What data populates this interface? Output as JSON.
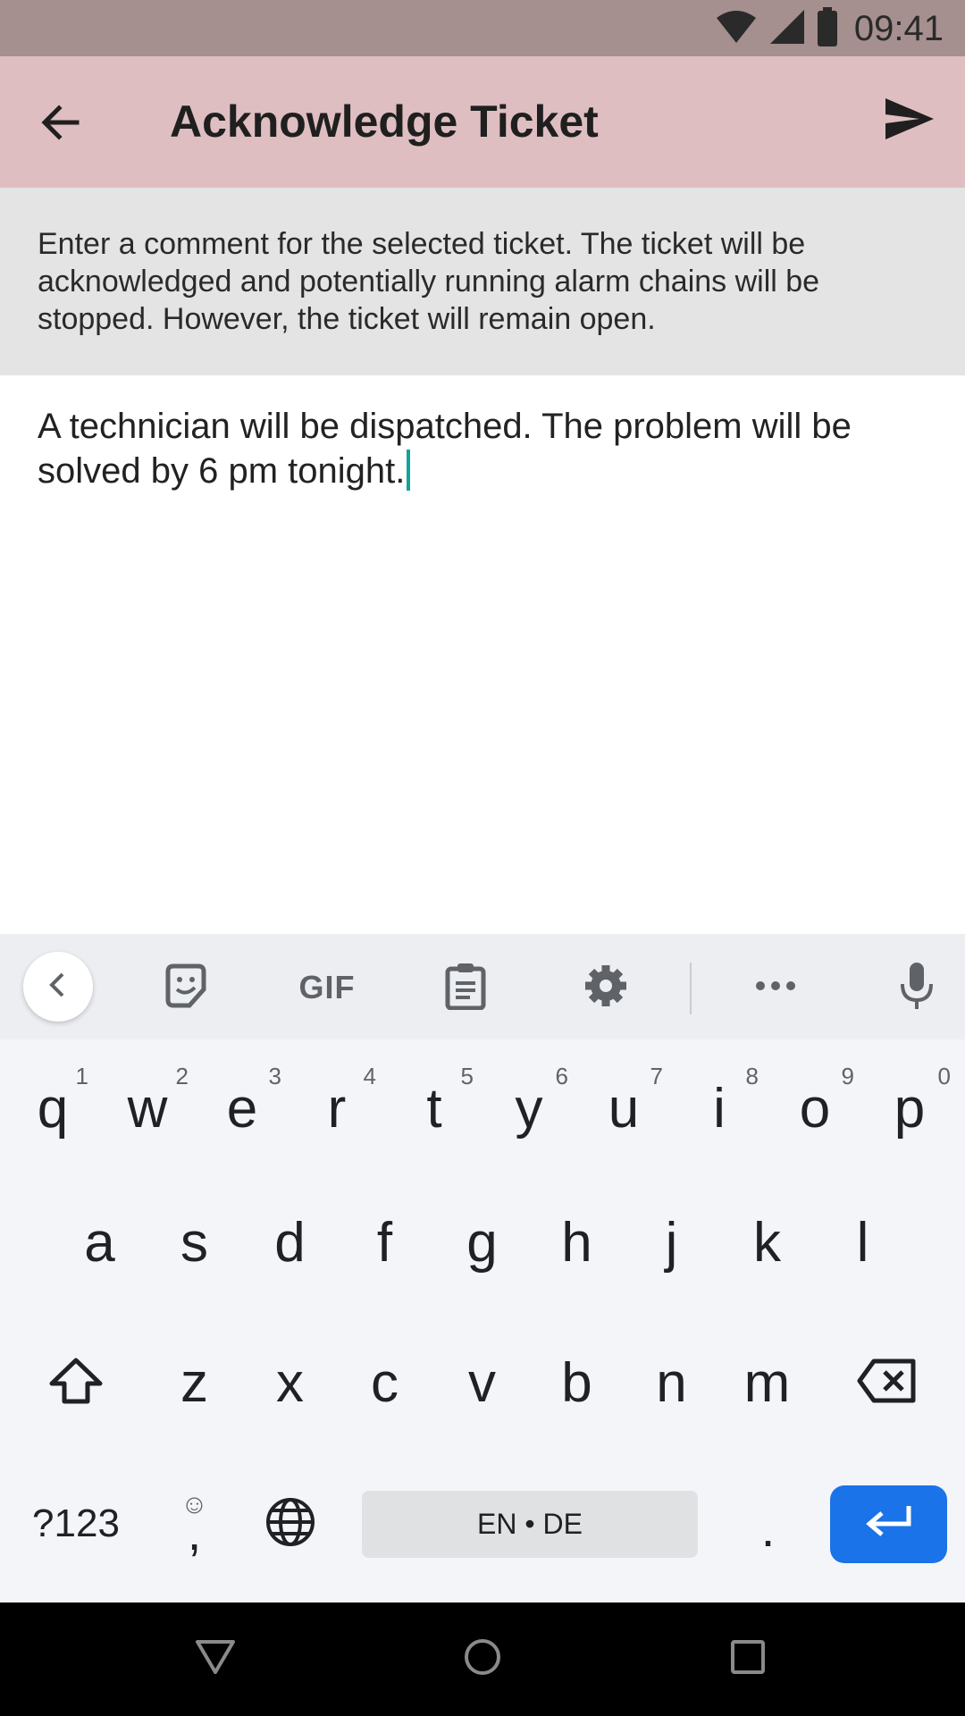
{
  "status_bar": {
    "time": "09:41"
  },
  "app_bar": {
    "title": "Acknowledge Ticket"
  },
  "info": {
    "text": "Enter a comment for the selected ticket. The ticket will be acknowledged and potentially running alarm chains will be stopped. However, the ticket will remain open."
  },
  "comment": {
    "value": "A technician will be dispatched. The problem will be solved by 6 pm tonight."
  },
  "keyboard": {
    "toolbar": {
      "gif_label": "GIF"
    },
    "row1": [
      {
        "letter": "q",
        "hint": "1"
      },
      {
        "letter": "w",
        "hint": "2"
      },
      {
        "letter": "e",
        "hint": "3"
      },
      {
        "letter": "r",
        "hint": "4"
      },
      {
        "letter": "t",
        "hint": "5"
      },
      {
        "letter": "y",
        "hint": "6"
      },
      {
        "letter": "u",
        "hint": "7"
      },
      {
        "letter": "i",
        "hint": "8"
      },
      {
        "letter": "o",
        "hint": "9"
      },
      {
        "letter": "p",
        "hint": "0"
      }
    ],
    "row2": [
      "a",
      "s",
      "d",
      "f",
      "g",
      "h",
      "j",
      "k",
      "l"
    ],
    "row3": [
      "z",
      "x",
      "c",
      "v",
      "b",
      "n",
      "m"
    ],
    "symbols_label": "?123",
    "comma_label": ",",
    "emoji_hint": "☺",
    "space_label": "EN • DE",
    "period_label": "."
  },
  "colors": {
    "status_bar": "#a58f8f",
    "app_bar": "#dfbec1",
    "info_panel": "#e4e4e4",
    "caret": "#12a39b",
    "enter_key": "#1a73e8"
  }
}
